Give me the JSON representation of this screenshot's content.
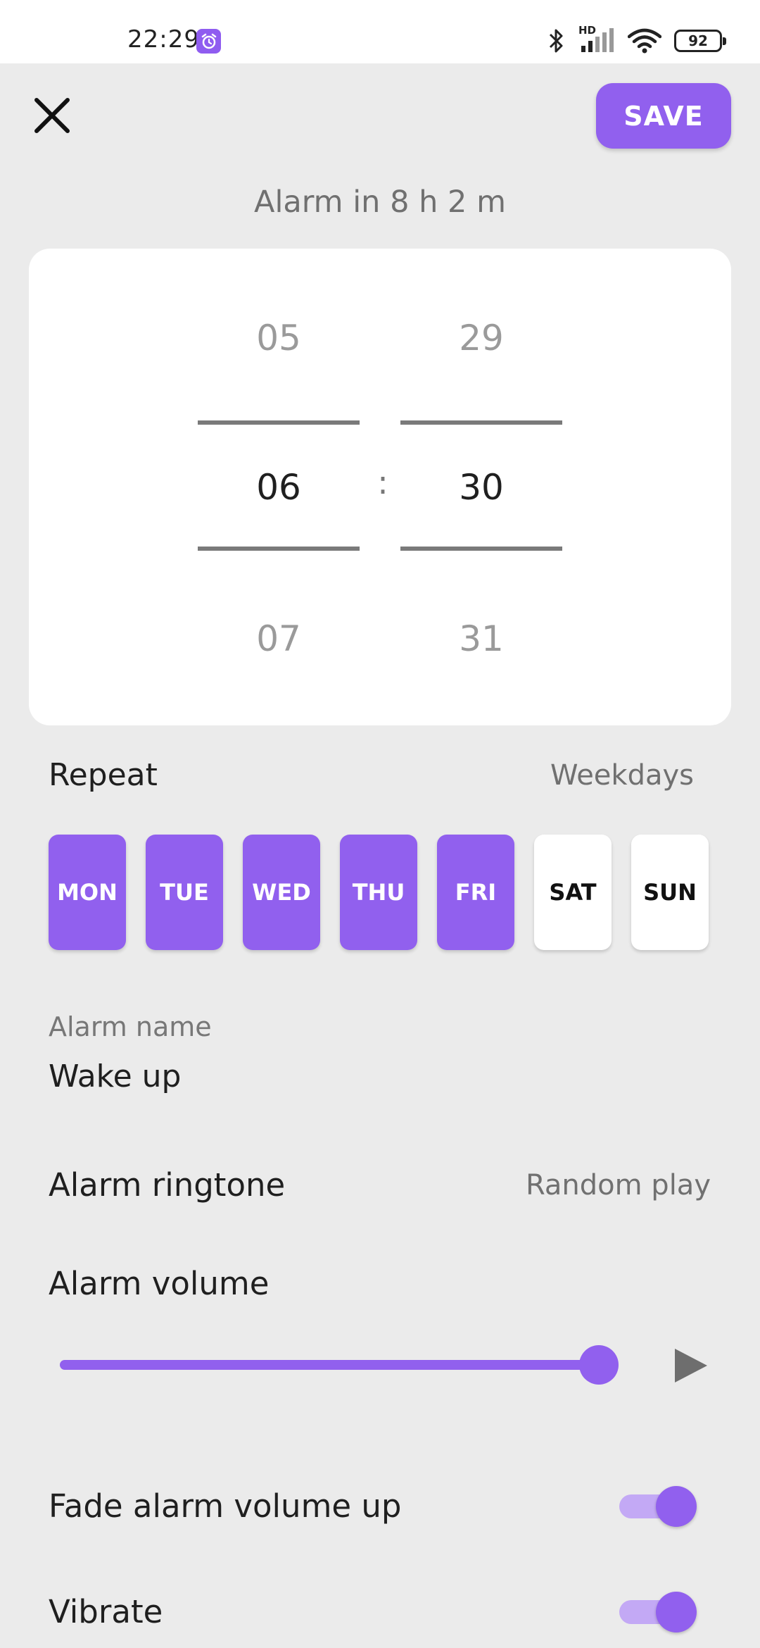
{
  "status_bar": {
    "time": "22:29",
    "battery": "92",
    "hd_label": "HD"
  },
  "header": {
    "save_label": "SAVE",
    "alarm_in": "Alarm in 8 h 2 m"
  },
  "picker": {
    "hours": {
      "prev": "05",
      "selected": "06",
      "next": "07"
    },
    "minutes": {
      "prev": "29",
      "selected": "30",
      "next": "31"
    },
    "separator": ":"
  },
  "repeat": {
    "label": "Repeat",
    "value": "Weekdays",
    "days": [
      {
        "label": "MON",
        "on": true
      },
      {
        "label": "TUE",
        "on": true
      },
      {
        "label": "WED",
        "on": true
      },
      {
        "label": "THU",
        "on": true
      },
      {
        "label": "FRI",
        "on": true
      },
      {
        "label": "SAT",
        "on": false
      },
      {
        "label": "SUN",
        "on": false
      }
    ]
  },
  "alarm_name": {
    "label": "Alarm name",
    "value": "Wake up"
  },
  "ringtone": {
    "label": "Alarm ringtone",
    "value": "Random play"
  },
  "volume": {
    "label": "Alarm volume",
    "level": 1.0
  },
  "toggles": {
    "fade_label": "Fade alarm volume up",
    "fade_on": true,
    "vibrate_label": "Vibrate",
    "vibrate_on": true
  },
  "colors": {
    "accent": "#9160ee",
    "accent_light": "#c3a9f5",
    "background": "#ebebeb"
  }
}
